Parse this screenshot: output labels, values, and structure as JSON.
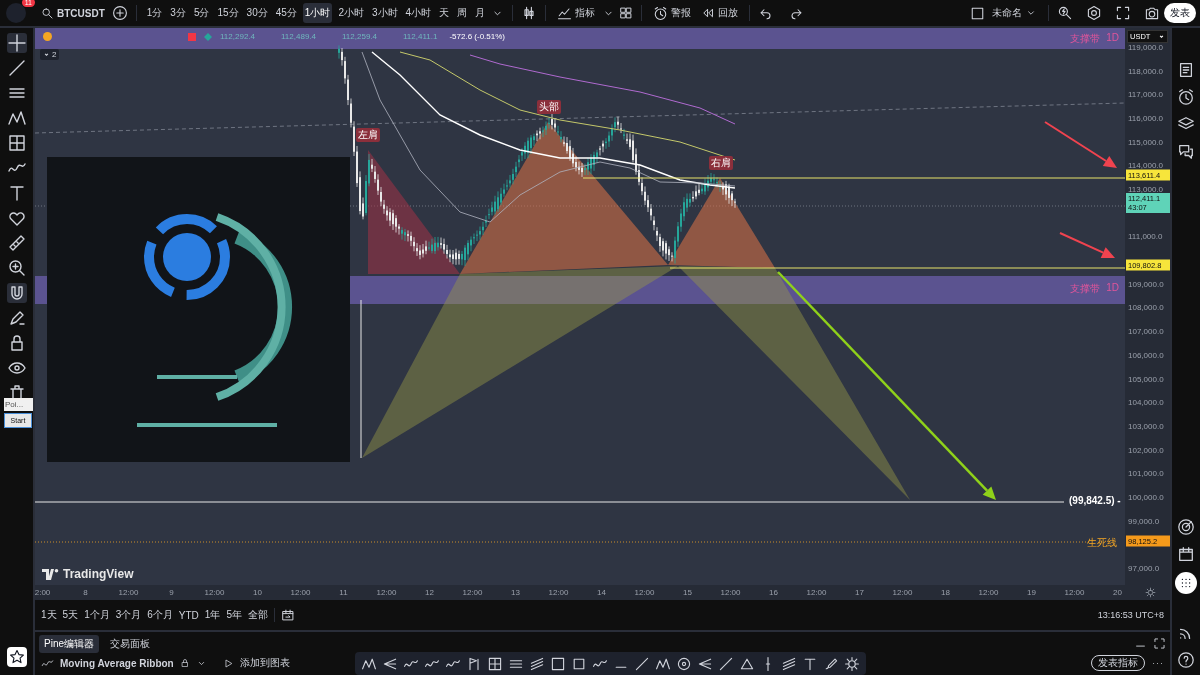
{
  "toolbar": {
    "avatar_badge": "11",
    "symbol": "BTCUSDT",
    "intervals": [
      {
        "label": "1分",
        "selected": false
      },
      {
        "label": "3分",
        "selected": false
      },
      {
        "label": "5分",
        "selected": false
      },
      {
        "label": "15分",
        "selected": false
      },
      {
        "label": "30分",
        "selected": false
      },
      {
        "label": "45分",
        "selected": false
      },
      {
        "label": "1小时",
        "selected": true
      },
      {
        "label": "2小时",
        "selected": false
      },
      {
        "label": "3小时",
        "selected": false
      },
      {
        "label": "4小时",
        "selected": false
      },
      {
        "label": "天",
        "selected": false
      },
      {
        "label": "周",
        "selected": false
      },
      {
        "label": "月",
        "selected": false
      }
    ],
    "indicators_label": "指标",
    "alert_label": "警报",
    "replay_label": "回放",
    "layout_name": "未命名",
    "publish_button": "发表"
  },
  "left_popup": {
    "text": "Poi...",
    "button": "Start"
  },
  "legend": {
    "values": [
      "112,292.4",
      "112,489.4",
      "112,259.4",
      "112,411.1"
    ],
    "change": "-572.6 (-0.51%)",
    "collapse_count": "2"
  },
  "chart": {
    "zones": [
      {
        "label": "支撑带",
        "timeframe": "1D"
      },
      {
        "label": "支撑带",
        "timeframe": "1D"
      }
    ],
    "pattern_labels": [
      "左肩",
      "头部",
      "右肩"
    ],
    "target_label": "(99,842.5) -",
    "line_label": "生死线",
    "brand": "TradingView"
  },
  "price_axis": {
    "currency": "USDT",
    "ticks": [
      "119,000.0",
      "118,000.0",
      "117,000.0",
      "116,000.0",
      "115,000.0",
      "114,000.0",
      "113,000.0",
      "111,000.0",
      "109,000.0",
      "108,000.0",
      "107,000.0",
      "106,000.0",
      "105,000.0",
      "104,000.0",
      "103,000.0",
      "102,000.0",
      "101,000.0",
      "100,000.0",
      "99,000.0",
      "97,000.0"
    ],
    "markers": [
      {
        "value": "113,611.4",
        "color": "#f7e53b"
      },
      {
        "value": "112,411.1",
        "countdown": "43:07",
        "color": "#5fd3b8"
      },
      {
        "value": "109,802.8",
        "color": "#f7e53b"
      },
      {
        "value": "98,125.2",
        "color": "#f59a1b"
      }
    ]
  },
  "time_axis": [
    "2:00",
    "8",
    "12:00",
    "9",
    "12:00",
    "10",
    "12:00",
    "11",
    "12:00",
    "12",
    "12:00",
    "13",
    "12:00",
    "14",
    "12:00",
    "15",
    "12:00",
    "16",
    "12:00",
    "17",
    "12:00",
    "18",
    "12:00",
    "19",
    "12:00",
    "20"
  ],
  "range_bar": {
    "ranges": [
      "1天",
      "5天",
      "1个月",
      "3个月",
      "6个月",
      "YTD",
      "1年",
      "5年",
      "全部"
    ],
    "clock": "13:16:53 UTC+8"
  },
  "bottom_panel": {
    "tabs": [
      {
        "label": "Pine编辑器",
        "selected": true
      },
      {
        "label": "交易面板",
        "selected": false
      }
    ],
    "script_name": "Moving Average Ribbon",
    "add_label": "添加到图表",
    "publish_label": "发表指标"
  }
}
